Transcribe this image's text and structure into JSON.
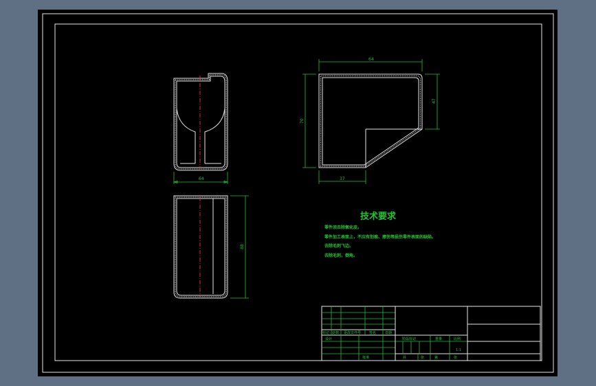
{
  "drawing": {
    "dimensions": {
      "front_width": "64",
      "top_width": "64",
      "top_height": "70",
      "top_right_height": "47",
      "top_bottom_width": "37",
      "side_height": "88"
    },
    "requirements": {
      "title": "技术要求",
      "lines": [
        "零件须去除氧化皮。",
        "零件加工表面上，不应有划痕、擦伤等损伤零件表面的缺陷。",
        "去除毛刺飞边。",
        "去除毛刺，倒角。"
      ]
    },
    "title_block": {
      "labels": {
        "biaoji": "标记",
        "chushu": "处数",
        "fenqu": "更改文件号",
        "qianming": "签名",
        "riqi": "日期",
        "sheji": "设计",
        "jieduan": "阶段标记",
        "zhongliang": "重量",
        "bili": "比例",
        "scale": "1:1",
        "gongyi": "工艺",
        "pizhun": "批准",
        "gong": "共",
        "zhang": "张",
        "di": "第",
        "zhang2": "张"
      }
    }
  }
}
